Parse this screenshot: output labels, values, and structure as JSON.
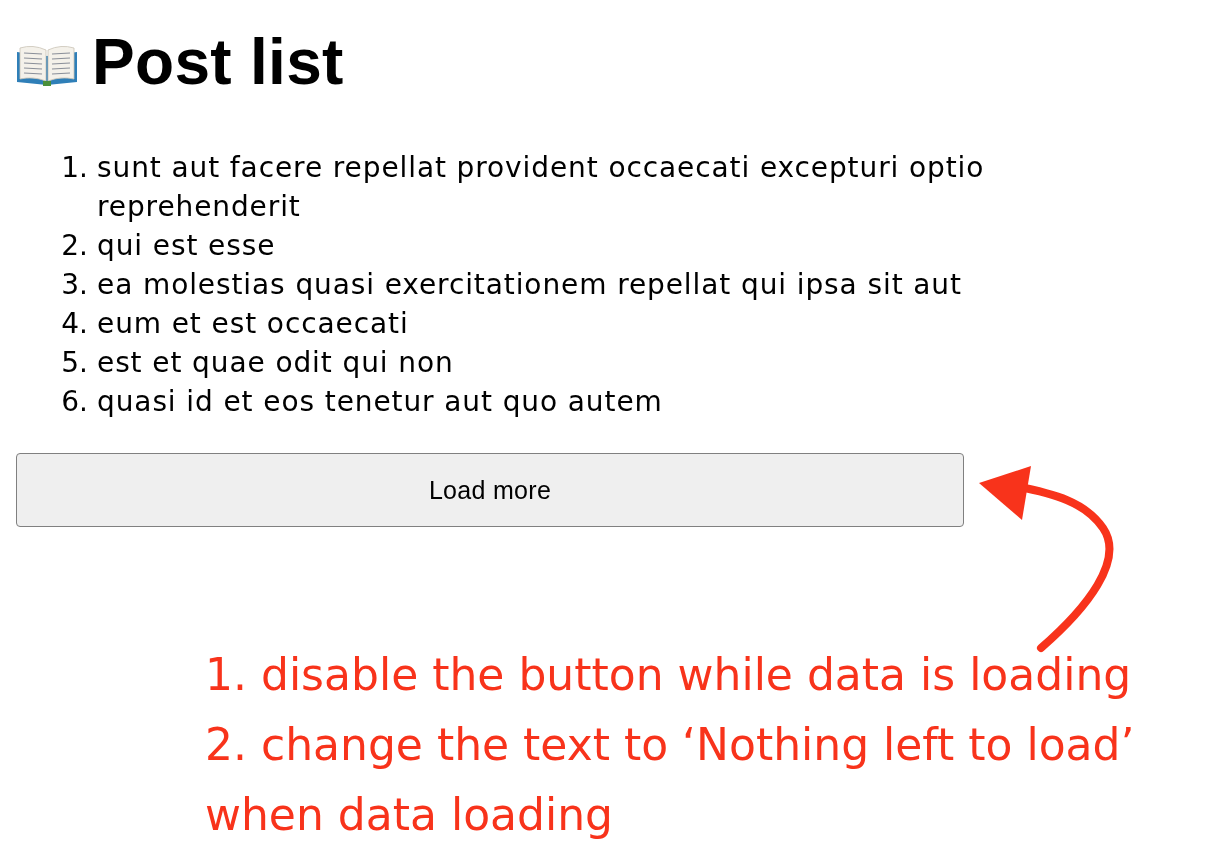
{
  "title": {
    "text": "Post list"
  },
  "posts": [
    {
      "number": "1.",
      "title": "sunt aut facere repellat provident occaecati excepturi optio reprehenderit"
    },
    {
      "number": "2.",
      "title": "qui est esse"
    },
    {
      "number": "3.",
      "title": "ea molestias quasi exercitationem repellat qui ipsa sit aut"
    },
    {
      "number": "4.",
      "title": "eum et est occaecati"
    },
    {
      "number": "5.",
      "title": "est et quae odit qui non"
    },
    {
      "number": "6.",
      "title": "quasi id et eos tenetur aut quo autem"
    }
  ],
  "load_more_button": {
    "label": "Load more"
  },
  "annotation": {
    "notes": [
      "1. disable the button while data is loading",
      "2. change the text to ‘Nothing left to load’ when data loading"
    ]
  }
}
